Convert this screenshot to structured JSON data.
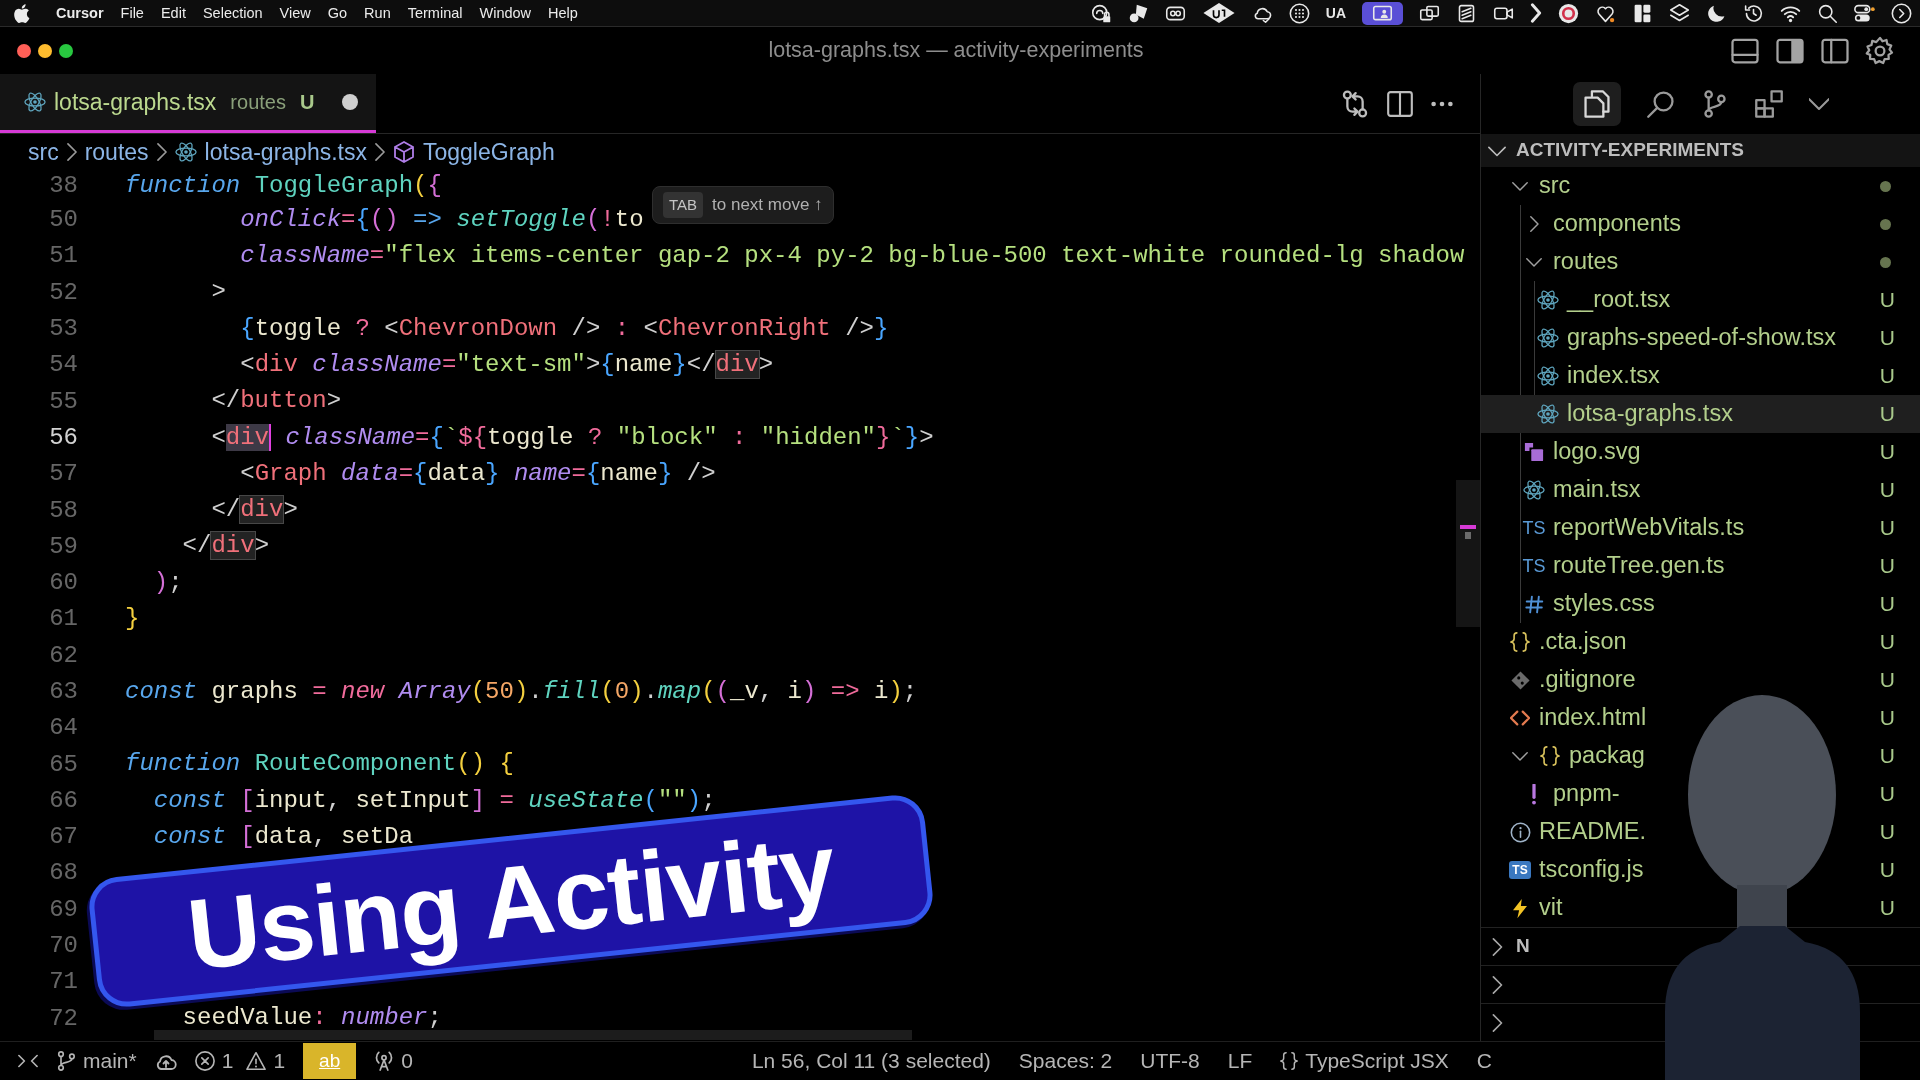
{
  "menu_bar": {
    "app": "Cursor",
    "menus": [
      "File",
      "Edit",
      "Selection",
      "View",
      "Go",
      "Run",
      "Terminal",
      "Window",
      "Help"
    ],
    "extras": [
      {
        "kind": "lock",
        "selected": false
      },
      {
        "kind": "shapes",
        "selected": false
      },
      {
        "kind": "tape",
        "selected": false
      },
      {
        "kind": "diamond",
        "selected": false
      },
      {
        "kind": "cloud",
        "selected": false
      },
      {
        "kind": "globe",
        "selected": false
      },
      {
        "kind": "text",
        "text": "UA",
        "selected": false
      },
      {
        "kind": "screen",
        "selected": true
      },
      {
        "kind": "windows",
        "selected": false
      },
      {
        "kind": "card",
        "selected": false
      },
      {
        "kind": "camera",
        "selected": false
      },
      {
        "kind": "chevron",
        "selected": false
      },
      {
        "kind": "disc",
        "selected": false
      },
      {
        "kind": "pin",
        "selected": false
      },
      {
        "kind": "grid",
        "selected": false
      },
      {
        "kind": "layers",
        "selected": false
      },
      {
        "kind": "moon",
        "selected": false
      },
      {
        "kind": "clock",
        "selected": false
      },
      {
        "kind": "wifi",
        "selected": false
      },
      {
        "kind": "search",
        "selected": false
      },
      {
        "kind": "toggles",
        "selected": false
      },
      {
        "kind": "siri",
        "selected": false
      }
    ]
  },
  "window": {
    "title": "lotsa-graphs.tsx — activity-experiments"
  },
  "editor": {
    "tabs": [
      {
        "label": "lotsa-graphs.tsx",
        "kind": "react",
        "description": "routes",
        "badge": "U",
        "dirty": true,
        "selected": true
      }
    ],
    "breadcrumbs": [
      {
        "label": "src",
        "kind": "folder"
      },
      {
        "label": "routes",
        "kind": "folder"
      },
      {
        "label": "lotsa-graphs.tsx",
        "kind": "react"
      },
      {
        "label": "ToggleGraph",
        "kind": "symbol"
      }
    ],
    "sticky_lines": [
      {
        "number": "38",
        "current": false,
        "tokens": [
          {
            "kind": "keyword",
            "text": "function "
          },
          {
            "kind": "function",
            "text": "ToggleGraph"
          },
          {
            "kind": "bracket1",
            "text": "("
          },
          {
            "kind": "bracket2",
            "text": "{"
          }
        ]
      }
    ],
    "lines": [
      {
        "number": "50",
        "current": false,
        "tokens": [
          {
            "kind": "attribute",
            "text": "        onClick"
          },
          {
            "kind": "operator",
            "text": "="
          },
          {
            "kind": "bracket3",
            "text": "{"
          },
          {
            "kind": "bracket2",
            "text": "() "
          },
          {
            "kind": "arrow",
            "text": "=> "
          },
          {
            "kind": "call",
            "text": "setToggle"
          },
          {
            "kind": "bracket2",
            "text": "("
          },
          {
            "kind": "operator",
            "text": "!"
          },
          {
            "kind": "identifier",
            "text": "to"
          }
        ]
      },
      {
        "number": "51",
        "current": false,
        "tokens": [
          {
            "kind": "attribute",
            "text": "        className"
          },
          {
            "kind": "operator",
            "text": "="
          },
          {
            "kind": "string",
            "text": "\"flex items-center gap-2 px-4 py-2 bg-blue-500 text-white rounded-lg shadow"
          }
        ]
      },
      {
        "number": "52",
        "current": false,
        "tokens": [
          {
            "kind": "punct",
            "text": "      >"
          }
        ]
      },
      {
        "number": "53",
        "current": false,
        "tokens": [
          {
            "kind": "bracket3",
            "text": "        {"
          },
          {
            "kind": "identifier",
            "text": "toggle "
          },
          {
            "kind": "operator",
            "text": "? "
          },
          {
            "kind": "punct",
            "text": "<"
          },
          {
            "kind": "tag",
            "text": "ChevronDown"
          },
          {
            "kind": "punct",
            "text": " /> "
          },
          {
            "kind": "operator",
            "text": ": "
          },
          {
            "kind": "punct",
            "text": "<"
          },
          {
            "kind": "tag",
            "text": "ChevronRight"
          },
          {
            "kind": "punct",
            "text": " />"
          },
          {
            "kind": "bracket3",
            "text": "}"
          }
        ]
      },
      {
        "number": "54",
        "current": false,
        "tokens": [
          {
            "kind": "punct",
            "text": "        <"
          },
          {
            "kind": "tag",
            "text": "div"
          },
          {
            "kind": "attribute",
            "text": " className"
          },
          {
            "kind": "operator",
            "text": "="
          },
          {
            "kind": "string",
            "text": "\"text-sm\""
          },
          {
            "kind": "punct",
            "text": ">"
          },
          {
            "kind": "bracket3",
            "text": "{"
          },
          {
            "kind": "identifier",
            "text": "name"
          },
          {
            "kind": "bracket3",
            "text": "}"
          },
          {
            "kind": "punct",
            "text": "</"
          },
          {
            "kind": "match",
            "text": "div"
          },
          {
            "kind": "punct",
            "text": ">"
          }
        ]
      },
      {
        "number": "55",
        "current": false,
        "tokens": [
          {
            "kind": "punct",
            "text": "      </"
          },
          {
            "kind": "tag",
            "text": "button"
          },
          {
            "kind": "punct",
            "text": ">"
          }
        ]
      },
      {
        "number": "56",
        "current": true,
        "tokens": [
          {
            "kind": "punct",
            "text": "      <"
          },
          {
            "kind": "selection",
            "text": "div"
          },
          {
            "kind": "attribute",
            "text": " className"
          },
          {
            "kind": "operator",
            "text": "="
          },
          {
            "kind": "bracket3",
            "text": "{"
          },
          {
            "kind": "string",
            "text": "`"
          },
          {
            "kind": "operator",
            "text": "${"
          },
          {
            "kind": "identifier",
            "text": "toggle "
          },
          {
            "kind": "operator",
            "text": "? "
          },
          {
            "kind": "string",
            "text": "\"block\""
          },
          {
            "kind": "operator",
            "text": " : "
          },
          {
            "kind": "string",
            "text": "\"hidden\""
          },
          {
            "kind": "operator",
            "text": "}"
          },
          {
            "kind": "string",
            "text": "`"
          },
          {
            "kind": "bracket3",
            "text": "}"
          },
          {
            "kind": "punct",
            "text": ">"
          }
        ]
      },
      {
        "number": "57",
        "current": false,
        "tokens": [
          {
            "kind": "punct",
            "text": "        <"
          },
          {
            "kind": "tag",
            "text": "Graph "
          },
          {
            "kind": "attribute",
            "text": "data"
          },
          {
            "kind": "operator",
            "text": "="
          },
          {
            "kind": "bracket3",
            "text": "{"
          },
          {
            "kind": "identifier",
            "text": "data"
          },
          {
            "kind": "bracket3",
            "text": "} "
          },
          {
            "kind": "attribute",
            "text": "name"
          },
          {
            "kind": "operator",
            "text": "="
          },
          {
            "kind": "bracket3",
            "text": "{"
          },
          {
            "kind": "identifier",
            "text": "name"
          },
          {
            "kind": "bracket3",
            "text": "}"
          },
          {
            "kind": "punct",
            "text": " />"
          }
        ]
      },
      {
        "number": "58",
        "current": false,
        "tokens": [
          {
            "kind": "punct",
            "text": "      </"
          },
          {
            "kind": "match",
            "text": "div"
          },
          {
            "kind": "punct",
            "text": ">"
          }
        ]
      },
      {
        "number": "59",
        "current": false,
        "tokens": [
          {
            "kind": "punct",
            "text": "    </"
          },
          {
            "kind": "match",
            "text": "div"
          },
          {
            "kind": "punct",
            "text": ">"
          }
        ]
      },
      {
        "number": "60",
        "current": false,
        "tokens": [
          {
            "kind": "bracket2",
            "text": "  )"
          },
          {
            "kind": "punct",
            "text": ";"
          }
        ]
      },
      {
        "number": "61",
        "current": false,
        "tokens": [
          {
            "kind": "bracket1",
            "text": "}"
          }
        ]
      },
      {
        "number": "62",
        "current": false
      },
      {
        "number": "63",
        "current": false,
        "tokens": [
          {
            "kind": "keyword",
            "text": "const "
          },
          {
            "kind": "identifier",
            "text": "graphs "
          },
          {
            "kind": "operator",
            "text": "= "
          },
          {
            "kind": "new",
            "text": "new "
          },
          {
            "kind": "type",
            "text": "Array"
          },
          {
            "kind": "bracket1",
            "text": "("
          },
          {
            "kind": "number",
            "text": "50"
          },
          {
            "kind": "bracket1",
            "text": ")"
          },
          {
            "kind": "punct",
            "text": "."
          },
          {
            "kind": "call",
            "text": "fill"
          },
          {
            "kind": "bracket1",
            "text": "("
          },
          {
            "kind": "number",
            "text": "0"
          },
          {
            "kind": "bracket1",
            "text": ")"
          },
          {
            "kind": "punct",
            "text": "."
          },
          {
            "kind": "call",
            "text": "map"
          },
          {
            "kind": "bracket1",
            "text": "("
          },
          {
            "kind": "bracket2",
            "text": "("
          },
          {
            "kind": "identifier",
            "text": "_v"
          },
          {
            "kind": "punct",
            "text": ", "
          },
          {
            "kind": "identifier",
            "text": "i"
          },
          {
            "kind": "bracket2",
            "text": ")"
          },
          {
            "kind": "operator",
            "text": " => "
          },
          {
            "kind": "identifier",
            "text": "i"
          },
          {
            "kind": "bracket1",
            "text": ")"
          },
          {
            "kind": "punct",
            "text": ";"
          }
        ]
      },
      {
        "number": "64",
        "current": false
      },
      {
        "number": "65",
        "current": false,
        "tokens": [
          {
            "kind": "keyword",
            "text": "function "
          },
          {
            "kind": "function",
            "text": "RouteComponent"
          },
          {
            "kind": "bracket1",
            "text": "() {"
          }
        ]
      },
      {
        "number": "66",
        "current": false,
        "tokens": [
          {
            "kind": "keyword",
            "text": "  const "
          },
          {
            "kind": "bracket2",
            "text": "["
          },
          {
            "kind": "identifier",
            "text": "input"
          },
          {
            "kind": "punct",
            "text": ", "
          },
          {
            "kind": "identifier",
            "text": "setInput"
          },
          {
            "kind": "bracket2",
            "text": "]"
          },
          {
            "kind": "operator",
            "text": " = "
          },
          {
            "kind": "call",
            "text": "useState"
          },
          {
            "kind": "bracket3",
            "text": "("
          },
          {
            "kind": "string",
            "text": "\"\""
          },
          {
            "kind": "bracket3",
            "text": ")"
          },
          {
            "kind": "punct",
            "text": ";"
          }
        ]
      },
      {
        "number": "67",
        "current": false,
        "tokens": [
          {
            "kind": "keyword",
            "text": "  const "
          },
          {
            "kind": "bracket2",
            "text": "["
          },
          {
            "kind": "identifier",
            "text": "data"
          },
          {
            "kind": "punct",
            "text": ", "
          },
          {
            "kind": "identifier",
            "text": "setDa"
          }
        ]
      },
      {
        "number": "68",
        "current": false
      },
      {
        "number": "69",
        "current": false
      },
      {
        "number": "70",
        "current": false
      },
      {
        "number": "71",
        "current": false
      },
      {
        "number": "72",
        "current": false,
        "tokens": [
          {
            "kind": "identifier",
            "text": "    seedValue"
          },
          {
            "kind": "operator",
            "text": ": "
          },
          {
            "kind": "type",
            "text": "number"
          },
          {
            "kind": "punct",
            "text": ";"
          }
        ]
      }
    ],
    "hint": {
      "key": "TAB",
      "text": "to next move ↑"
    }
  },
  "explorer": {
    "views": [
      {
        "kind": "files",
        "selected": true
      },
      {
        "kind": "search",
        "selected": false
      },
      {
        "kind": "source-control",
        "selected": false
      },
      {
        "kind": "extensions",
        "selected": false
      },
      {
        "kind": "more",
        "selected": false
      }
    ],
    "section": {
      "title": "ACTIVITY-EXPERIMENTS",
      "expanded": true
    },
    "tree": [
      {
        "label": "src",
        "kind": "folder",
        "expanded": true,
        "selected": false,
        "dot": true,
        "children": [
          {
            "label": "components",
            "kind": "folder",
            "expanded": false,
            "selected": false,
            "dot": true
          },
          {
            "label": "routes",
            "kind": "folder",
            "expanded": true,
            "selected": false,
            "dot": true,
            "children": [
              {
                "label": "__root.tsx",
                "kind": "react",
                "selected": false,
                "dot": false,
                "badge": "U"
              },
              {
                "label": "graphs-speed-of-show.tsx",
                "kind": "react",
                "selected": false,
                "dot": false,
                "badge": "U"
              },
              {
                "label": "index.tsx",
                "kind": "react",
                "selected": false,
                "dot": false,
                "badge": "U"
              },
              {
                "label": "lotsa-graphs.tsx",
                "kind": "react",
                "selected": true,
                "dot": false,
                "badge": "U"
              }
            ]
          },
          {
            "label": "logo.svg",
            "kind": "svg",
            "selected": false,
            "dot": false,
            "badge": "U"
          },
          {
            "label": "main.tsx",
            "kind": "react",
            "selected": false,
            "dot": false,
            "badge": "U"
          },
          {
            "label": "reportWebVitals.ts",
            "kind": "ts",
            "icon_text": "TS",
            "selected": false,
            "dot": false,
            "badge": "U"
          },
          {
            "label": "routeTree.gen.ts",
            "kind": "ts",
            "icon_text": "TS",
            "selected": false,
            "dot": false,
            "badge": "U"
          },
          {
            "label": "styles.css",
            "kind": "css",
            "selected": false,
            "dot": false,
            "badge": "U"
          }
        ]
      },
      {
        "label": ".cta.json",
        "kind": "json",
        "selected": false,
        "dot": false,
        "badge": "U"
      },
      {
        "label": ".gitignore",
        "kind": "git",
        "selected": false,
        "dot": false,
        "badge": "U"
      },
      {
        "label": "index.html",
        "kind": "html",
        "selected": false,
        "dot": false,
        "badge": "U"
      },
      {
        "label": "packag",
        "kind": "json",
        "expanded": true,
        "selected": false,
        "dot": false,
        "badge": "U",
        "children": [
          {
            "label": "pnpm-",
            "kind": "yaml",
            "selected": false,
            "dot": false,
            "badge": "U"
          }
        ]
      },
      {
        "label": "README.",
        "kind": "info",
        "selected": false,
        "dot": false,
        "badge": "U"
      },
      {
        "label": "tsconfig.js",
        "kind": "tsconfig",
        "icon_text": "TS",
        "selected": false,
        "dot": false,
        "badge": "U"
      },
      {
        "label": "vit",
        "kind": "vite",
        "selected": false,
        "dot": false,
        "badge": "U"
      }
    ],
    "sections": [
      {
        "label": "N",
        "expanded": false
      },
      {
        "expanded": false
      },
      {
        "expanded": false
      }
    ]
  },
  "status_bar": {
    "left": [
      {
        "kind": "remote"
      },
      {
        "kind": "branch",
        "text": "main*"
      },
      {
        "kind": "sync"
      },
      {
        "kind": "problems",
        "errors": "1",
        "warnings": "1"
      },
      {
        "kind": "highlight",
        "text": "ab"
      },
      {
        "kind": "ports",
        "text": "0"
      }
    ],
    "right": [
      {
        "kind": "position",
        "text": "Ln 56, Col 11 (3 selected)"
      },
      {
        "kind": "indent",
        "text": "Spaces: 2"
      },
      {
        "kind": "encoding",
        "text": "UTF-8"
      },
      {
        "kind": "eol",
        "text": "LF"
      },
      {
        "kind": "language",
        "text": "TypeScript JSX"
      },
      {
        "kind": "item",
        "text": "C"
      }
    ]
  },
  "banner": {
    "text": "Using Activity"
  },
  "webcam_overlay": {
    "kind": "person"
  }
}
